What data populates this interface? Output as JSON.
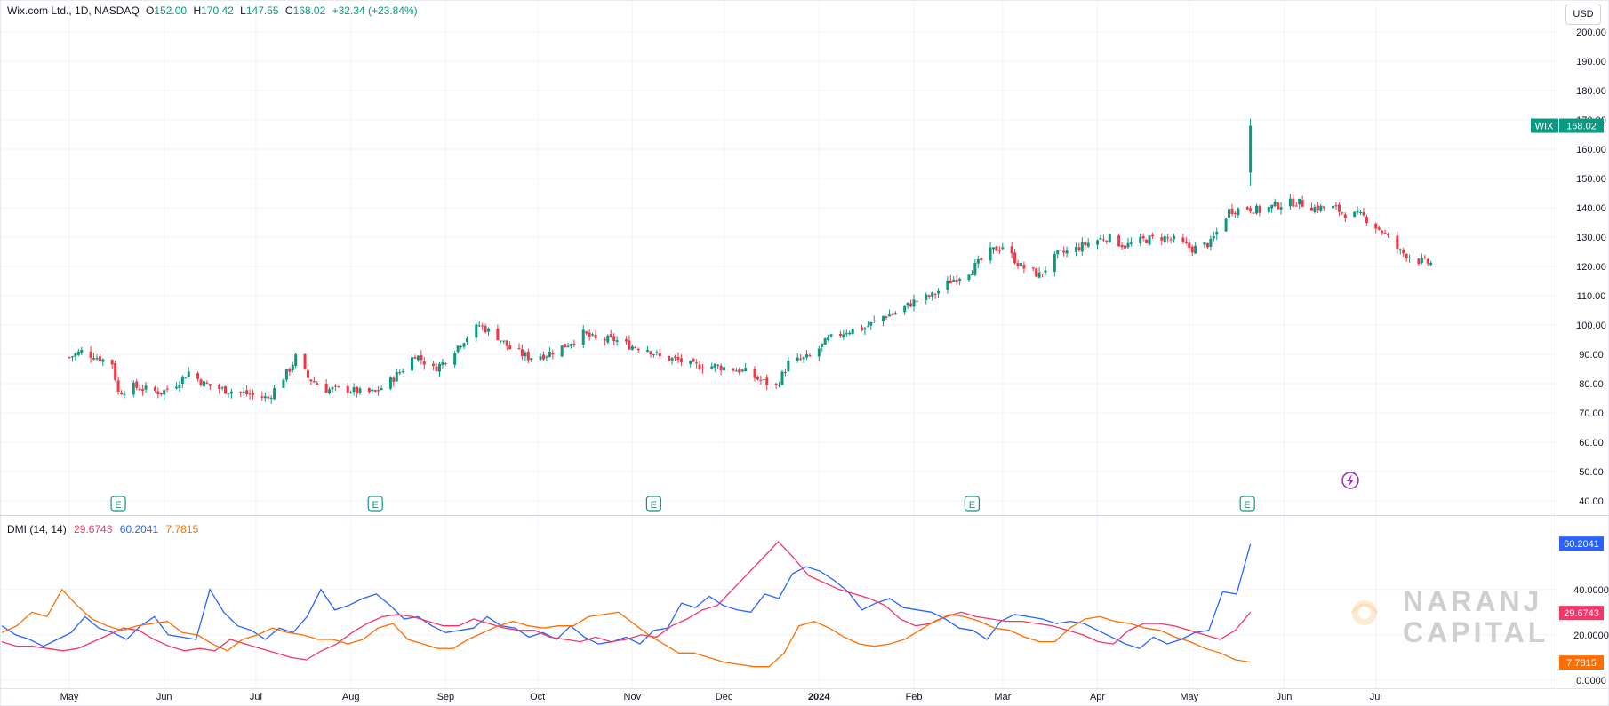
{
  "header": {
    "symbol": "Wix.com Ltd., 1D, NASDAQ",
    "open_label": "O",
    "open": "152.00",
    "high_label": "H",
    "high": "170.42",
    "low_label": "L",
    "low": "147.55",
    "close_label": "C",
    "close": "168.02",
    "change": "+32.34 (+23.84%)"
  },
  "currency_button": "USD",
  "price_tag": {
    "ticker": "WIX",
    "value": "168.02"
  },
  "indicator": {
    "name": "DMI (14, 14)",
    "values": [
      "29.6743",
      "60.2041",
      "7.7815"
    ],
    "colors": [
      "#f23668",
      "#2962ff",
      "#ff6d00"
    ],
    "tags": [
      {
        "value": "60.2041",
        "color": "#2962ff"
      },
      {
        "value": "29.6743",
        "color": "#f23668"
      },
      {
        "value": "7.7815",
        "color": "#ff6d00"
      }
    ]
  },
  "earnings_marker": "E",
  "watermark": {
    "line1": "NARANJ",
    "line2": "CAPITAL"
  },
  "colors": {
    "up": "#089981",
    "down": "#f23645",
    "grid": "#f0f3fa"
  },
  "chart_data": [
    {
      "type": "candlestick",
      "title": "Wix.com Ltd., 1D, NASDAQ",
      "y_ticks": [
        "200.00",
        "190.00",
        "180.00",
        "170.00",
        "160.00",
        "150.00",
        "140.00",
        "130.00",
        "120.00",
        "110.00",
        "100.00",
        "90.00",
        "80.00",
        "70.00",
        "60.00",
        "50.00",
        "40.00"
      ],
      "ylim": [
        40,
        200
      ],
      "x_ticks": [
        "May",
        "Jun",
        "Jul",
        "Aug",
        "Sep",
        "Oct",
        "Nov",
        "Dec",
        "2024",
        "Feb",
        "Mar",
        "Apr",
        "May",
        "Jun",
        "Jul"
      ],
      "x_range": [
        "2023-05-01",
        "2024-07-31"
      ],
      "earnings_dates": [
        "2023-05-17",
        "2023-08-09",
        "2023-11-08",
        "2024-02-20",
        "2024-05-20"
      ],
      "close": [
        [
          "2023-05-01",
          89
        ],
        [
          "2023-05-05",
          91
        ],
        [
          "2023-05-10",
          89
        ],
        [
          "2023-05-15",
          87
        ],
        [
          "2023-05-17",
          77
        ],
        [
          "2023-05-22",
          79
        ],
        [
          "2023-05-26",
          78
        ],
        [
          "2023-05-31",
          77
        ],
        [
          "2023-06-05",
          80
        ],
        [
          "2023-06-09",
          84
        ],
        [
          "2023-06-14",
          80
        ],
        [
          "2023-06-20",
          78
        ],
        [
          "2023-06-26",
          77
        ],
        [
          "2023-06-30",
          76
        ],
        [
          "2023-07-05",
          75
        ],
        [
          "2023-07-07",
          78
        ],
        [
          "2023-07-12",
          85
        ],
        [
          "2023-07-14",
          89
        ],
        [
          "2023-07-18",
          82
        ],
        [
          "2023-07-24",
          78
        ],
        [
          "2023-07-31",
          78
        ],
        [
          "2023-08-04",
          77
        ],
        [
          "2023-08-09",
          77
        ],
        [
          "2023-08-14",
          81
        ],
        [
          "2023-08-18",
          85
        ],
        [
          "2023-08-22",
          90
        ],
        [
          "2023-08-28",
          85
        ],
        [
          "2023-08-31",
          87
        ],
        [
          "2023-09-06",
          94
        ],
        [
          "2023-09-12",
          100
        ],
        [
          "2023-09-18",
          96
        ],
        [
          "2023-09-22",
          92
        ],
        [
          "2023-09-28",
          89
        ],
        [
          "2023-10-04",
          90
        ],
        [
          "2023-10-10",
          93
        ],
        [
          "2023-10-16",
          97
        ],
        [
          "2023-10-20",
          95
        ],
        [
          "2023-10-26",
          95
        ],
        [
          "2023-10-31",
          93
        ],
        [
          "2023-11-06",
          92
        ],
        [
          "2023-11-10",
          89
        ],
        [
          "2023-11-16",
          88
        ],
        [
          "2023-11-21",
          86
        ],
        [
          "2023-11-28",
          86
        ],
        [
          "2023-12-04",
          85
        ],
        [
          "2023-12-08",
          84
        ],
        [
          "2023-12-13",
          81
        ],
        [
          "2023-12-18",
          79
        ],
        [
          "2023-12-22",
          87
        ],
        [
          "2023-12-29",
          89
        ],
        [
          "2024-01-04",
          95
        ],
        [
          "2024-01-10",
          98
        ],
        [
          "2024-01-16",
          99
        ],
        [
          "2024-01-22",
          103
        ],
        [
          "2024-01-26",
          104
        ],
        [
          "2024-02-01",
          108
        ],
        [
          "2024-02-07",
          110
        ],
        [
          "2024-02-13",
          115
        ],
        [
          "2024-02-20",
          119
        ],
        [
          "2024-02-26",
          125
        ],
        [
          "2024-03-01",
          127
        ],
        [
          "2024-03-07",
          120
        ],
        [
          "2024-03-13",
          117
        ],
        [
          "2024-03-19",
          124
        ],
        [
          "2024-03-25",
          126
        ],
        [
          "2024-03-29",
          128
        ],
        [
          "2024-04-04",
          130
        ],
        [
          "2024-04-10",
          127
        ],
        [
          "2024-04-16",
          129
        ],
        [
          "2024-04-22",
          130
        ],
        [
          "2024-04-26",
          129
        ],
        [
          "2024-05-02",
          126
        ],
        [
          "2024-05-08",
          128
        ],
        [
          "2024-05-14",
          139
        ],
        [
          "2024-05-20",
          140
        ],
        [
          "2024-05-24",
          139
        ],
        [
          "2024-05-30",
          141
        ],
        [
          "2024-06-05",
          142
        ],
        [
          "2024-06-11",
          140
        ],
        [
          "2024-06-17",
          140
        ],
        [
          "2024-06-21",
          138
        ],
        [
          "2024-06-27",
          137
        ],
        [
          "2024-07-03",
          132
        ],
        [
          "2024-07-09",
          125
        ],
        [
          "2024-07-15",
          122
        ],
        [
          "2024-07-19",
          121
        ]
      ],
      "last": {
        "open": 152.0,
        "high": 170.42,
        "low": 147.55,
        "close": 168.02
      }
    },
    {
      "type": "line",
      "title": "DMI (14, 14)",
      "series": [
        {
          "name": "+DI",
          "color": "#2962ff",
          "last": 60.2041
        },
        {
          "name": "-DI",
          "color": "#f23668",
          "last": 29.6743
        },
        {
          "name": "ADX",
          "color": "#ff6d00",
          "last": 7.7815
        }
      ],
      "y_ticks": [
        "40.0000",
        "20.0000",
        "0.0000"
      ],
      "ylim": [
        0,
        63
      ],
      "plus_di": [
        24,
        20,
        18,
        15,
        18,
        21,
        28,
        23,
        21,
        18,
        24,
        28,
        20,
        19,
        18,
        40,
        30,
        24,
        22,
        18,
        23,
        21,
        28,
        40,
        31,
        33,
        36,
        38,
        33,
        27,
        28,
        24,
        21,
        22,
        23,
        28,
        24,
        23,
        19,
        21,
        18,
        24,
        19,
        16,
        17,
        19,
        16,
        22,
        23,
        34,
        32,
        37,
        33,
        31,
        30,
        38,
        36,
        47,
        50,
        48,
        44,
        39,
        31,
        34,
        36,
        32,
        31,
        30,
        27,
        23,
        22,
        18,
        26,
        29,
        28,
        27,
        25,
        26,
        25,
        22,
        19,
        16,
        14,
        19,
        16,
        18,
        21,
        22,
        39,
        38,
        60
      ],
      "minus_di": [
        17,
        15,
        15,
        14,
        13,
        14,
        17,
        20,
        23,
        22,
        18,
        15,
        13,
        14,
        13,
        18,
        16,
        14,
        12,
        10,
        9,
        13,
        16,
        21,
        25,
        28,
        29,
        28,
        26,
        24,
        24,
        27,
        25,
        23,
        22,
        22,
        19,
        18,
        17,
        19,
        17,
        18,
        20,
        19,
        24,
        27,
        31,
        33,
        40,
        47,
        54,
        61,
        54,
        46,
        43,
        40,
        38,
        36,
        33,
        27,
        24,
        25,
        28,
        30,
        28,
        27,
        26,
        26,
        25,
        24,
        22,
        20,
        17,
        16,
        22,
        25,
        25,
        24,
        22,
        20,
        18,
        22,
        30
      ],
      "adx": [
        21,
        24,
        30,
        28,
        40,
        33,
        27,
        24,
        22,
        24,
        25,
        26,
        21,
        20,
        16,
        13,
        18,
        20,
        23,
        21,
        20,
        18,
        18,
        16,
        18,
        23,
        25,
        18,
        16,
        14,
        14,
        18,
        21,
        24,
        26,
        24,
        23,
        24,
        24,
        28,
        29,
        30,
        25,
        20,
        16,
        12,
        12,
        10,
        8,
        7,
        6,
        6,
        12,
        24,
        26,
        23,
        19,
        16,
        15,
        16,
        18,
        22,
        26,
        29,
        28,
        26,
        23,
        22,
        19,
        17,
        17,
        23,
        27,
        28,
        26,
        25,
        23,
        22,
        19,
        17,
        14,
        12,
        9,
        8
      ]
    }
  ]
}
